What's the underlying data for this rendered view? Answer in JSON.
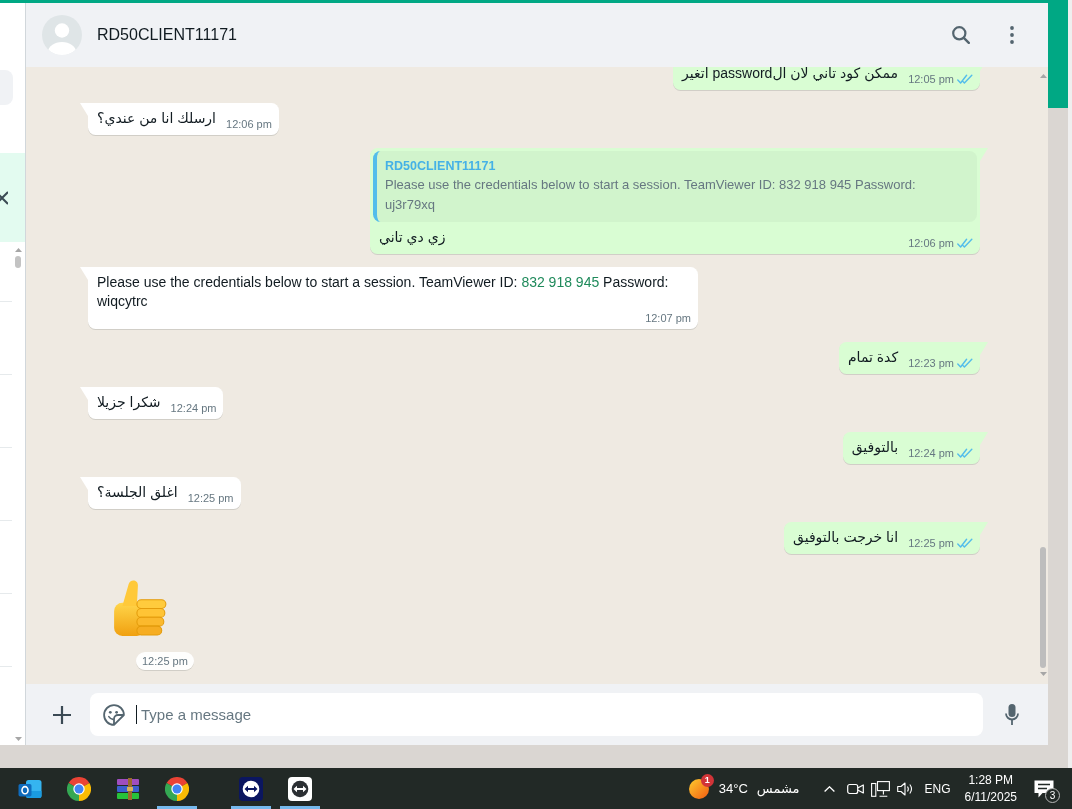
{
  "chat_header": {
    "contact_name": "RD50CLIENT11171"
  },
  "messages": [
    {
      "kind": "text",
      "outgoing": true,
      "parts": [
        {
          "kind": "plain",
          "text": "ممكن كود تاني لان الpassword اتغير"
        }
      ],
      "time": "12:05 pm",
      "read": true
    },
    {
      "kind": "text",
      "outgoing": false,
      "parts": [
        {
          "kind": "plain",
          "text": "ارسلك انا من عندي؟"
        }
      ],
      "time": "12:06 pm"
    },
    {
      "kind": "reply",
      "outgoing": true,
      "quote": {
        "author": "RD50CLIENT11171",
        "text": "Please use the credentials below to start a session. TeamViewer ID: 832 918 945 Password: uj3r79xq"
      },
      "parts": [
        {
          "kind": "plain",
          "text": "زي دي تاني"
        }
      ],
      "time": "12:06 pm",
      "read": true
    },
    {
      "kind": "text",
      "outgoing": false,
      "parts": [
        {
          "kind": "plain",
          "text": "Please use the credentials below to start a session. TeamViewer ID: "
        },
        {
          "kind": "link",
          "text": "832 918 945"
        },
        {
          "kind": "plain",
          "text": " Password: wiqcytrc"
        }
      ],
      "time": "12:07 pm"
    },
    {
      "kind": "text",
      "outgoing": true,
      "parts": [
        {
          "kind": "plain",
          "text": "كدة تمام"
        }
      ],
      "time": "12:23 pm",
      "read": true
    },
    {
      "kind": "text",
      "outgoing": false,
      "parts": [
        {
          "kind": "plain",
          "text": "شكرا جزيلا"
        }
      ],
      "time": "12:24 pm"
    },
    {
      "kind": "text",
      "outgoing": true,
      "parts": [
        {
          "kind": "plain",
          "text": "بالتوفيق"
        }
      ],
      "time": "12:24 pm",
      "read": true
    },
    {
      "kind": "text",
      "outgoing": false,
      "parts": [
        {
          "kind": "plain",
          "text": "اغلق الجلسة؟"
        }
      ],
      "time": "12:25 pm"
    },
    {
      "kind": "text",
      "outgoing": true,
      "parts": [
        {
          "kind": "plain",
          "text": "انا خرجت بالتوفيق"
        }
      ],
      "time": "12:25 pm",
      "read": true
    },
    {
      "kind": "sticker",
      "outgoing": false,
      "time": "12:25 pm"
    }
  ],
  "composer": {
    "placeholder": "Type a message"
  },
  "taskbar": {
    "apps": [
      {
        "kind": "mail",
        "running": false
      },
      {
        "kind": "browser",
        "running": false
      },
      {
        "kind": "archive",
        "running": false
      },
      {
        "kind": "browser",
        "running": true
      },
      {
        "kind": "remote",
        "running": true
      },
      {
        "kind": "remotelight",
        "running": true
      }
    ],
    "weather": {
      "alert_count": "1",
      "temperature": "34°C",
      "condition": "مشمس"
    },
    "language": "ENG",
    "time": "1:28 PM",
    "date": "6/11/2025",
    "notification_count": "3"
  }
}
